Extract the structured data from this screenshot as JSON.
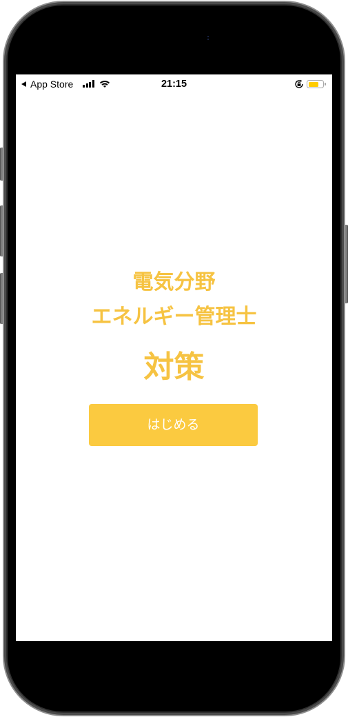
{
  "status_bar": {
    "back_label": "App Store",
    "time": "21:15",
    "signal_bars": 4,
    "battery_level": 0.7,
    "icons": {
      "back": "back-triangle-icon",
      "signal": "cellular-signal-icon",
      "wifi": "wifi-icon",
      "orientation_lock": "orientation-lock-icon",
      "battery": "battery-icon"
    }
  },
  "main": {
    "subtitle_line1": "電気分野",
    "subtitle_line2": "エネルギー管理士",
    "title": "対策",
    "start_button_label": "はじめる"
  },
  "colors": {
    "accent": "#F6C342",
    "button_background": "#FBCA40",
    "button_text": "#FFFFFF",
    "battery_fill": "#FFCC00"
  }
}
